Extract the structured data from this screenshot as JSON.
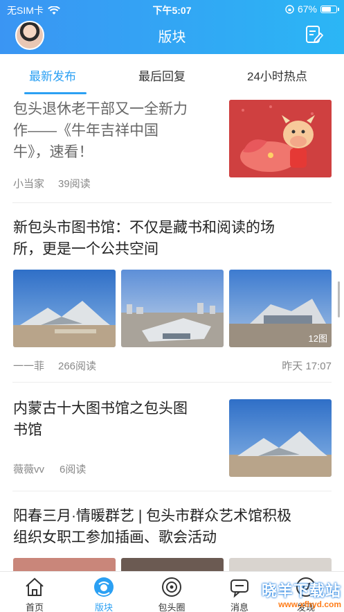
{
  "status": {
    "carrier": "无SIM卡",
    "time": "下午5:07",
    "battery": "67%",
    "battery_level": 0.67
  },
  "header": {
    "title": "版块"
  },
  "tabs": [
    {
      "label": "最新发布",
      "active": true
    },
    {
      "label": "最后回复",
      "active": false
    },
    {
      "label": "24小时热点",
      "active": false
    }
  ],
  "feed": [
    {
      "title_lines": [
        "包头退休老干部又一全新力",
        "作——《牛年吉祥中国",
        "牛》，速看！"
      ],
      "author": "小当家",
      "reads": "39阅读"
    },
    {
      "title_lines": [
        "新包头市图书馆：不仅是藏书和阅读的场",
        "所，更是一个公共空间"
      ],
      "author": "一一菲",
      "reads": "266阅读",
      "image_count": "12图",
      "time": "昨天 17:07"
    },
    {
      "title_lines": [
        "内蒙古十大图书馆之包头图",
        "书馆"
      ],
      "author": "薇薇vv",
      "reads": "6阅读"
    },
    {
      "title_lines": [
        "阳春三月·情暖群艺 | 包头市群众艺术馆积极",
        "组织女职工参加插画、歌会活动"
      ]
    }
  ],
  "tabbar": [
    {
      "label": "首页",
      "icon": "home-icon",
      "active": false
    },
    {
      "label": "版块",
      "icon": "board-icon",
      "active": true
    },
    {
      "label": "包头圈",
      "icon": "circle-icon",
      "active": false
    },
    {
      "label": "消息",
      "icon": "message-icon",
      "active": false
    },
    {
      "label": "发现",
      "icon": "discover-icon",
      "active": false
    }
  ],
  "watermark": {
    "line1": "晓羊下载站",
    "line2": "www.xfhyd.com"
  },
  "colors": {
    "accent": "#2ba0f3",
    "header_start": "#3a95f3",
    "header_end": "#2bb6f5"
  }
}
